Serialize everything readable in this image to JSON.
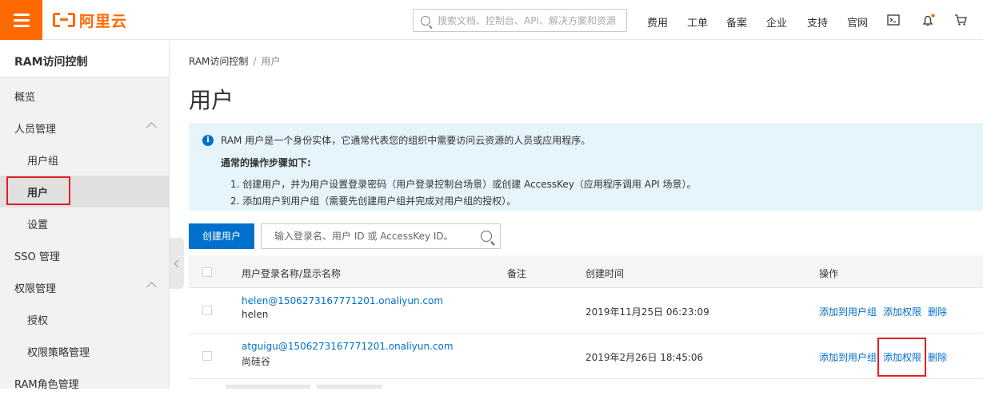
{
  "topbar": {
    "logo_text": "阿里云",
    "search_placeholder": "搜索文档、控制台、API、解决方案和资源",
    "nav": [
      "费用",
      "工单",
      "备案",
      "企业",
      "支持",
      "官网"
    ],
    "accent": "#ff6a00"
  },
  "sidebar": {
    "title": "RAM访问控制",
    "items": [
      {
        "label": "概览",
        "sub": false
      },
      {
        "label": "人员管理",
        "sub": false,
        "expanded": true
      },
      {
        "label": "用户组",
        "sub": true
      },
      {
        "label": "用户",
        "sub": true,
        "active": true
      },
      {
        "label": "设置",
        "sub": true
      },
      {
        "label": "SSO 管理",
        "sub": false
      },
      {
        "label": "权限管理",
        "sub": false,
        "expanded": true
      },
      {
        "label": "授权",
        "sub": true
      },
      {
        "label": "权限策略管理",
        "sub": true
      },
      {
        "label": "RAM角色管理",
        "sub": false
      }
    ]
  },
  "breadcrumb": {
    "parent": "RAM访问控制",
    "separator": "/",
    "current": "用户"
  },
  "page_title": "用户",
  "info": {
    "intro": "RAM 用户是一个身份实体，它通常代表您的组织中需要访问云资源的人员或应用程序。",
    "heading": "通常的操作步骤如下:",
    "step1": "1. 创建用户，并为用户设置登录密码（用户登录控制台场景）或创建 AccessKey（应用程序调用 API 场景）。",
    "step2": "2. 添加用户到用户组（需要先创建用户组并完成对用户组的授权）。"
  },
  "toolbar": {
    "create_label": "创建用户",
    "search_placeholder": "输入登录名、用户 ID 或 AccessKey ID。"
  },
  "table": {
    "columns": [
      "用户登录名称/显示名称",
      "备注",
      "创建时间",
      "操作"
    ],
    "rows": [
      {
        "login": "helen@1506273167771201.onaliyun.com",
        "display": "helen",
        "note": "",
        "created": "2019年11月25日 06:23:09",
        "ops": [
          "添加到用户组",
          "添加权限",
          "删除"
        ]
      },
      {
        "login": "atguigu@1506273167771201.onaliyun.com",
        "display": "尚硅谷",
        "note": "",
        "created": "2019年2月26日 18:45:06",
        "ops": [
          "添加到用户组",
          "添加权限",
          "删除"
        ]
      }
    ]
  }
}
